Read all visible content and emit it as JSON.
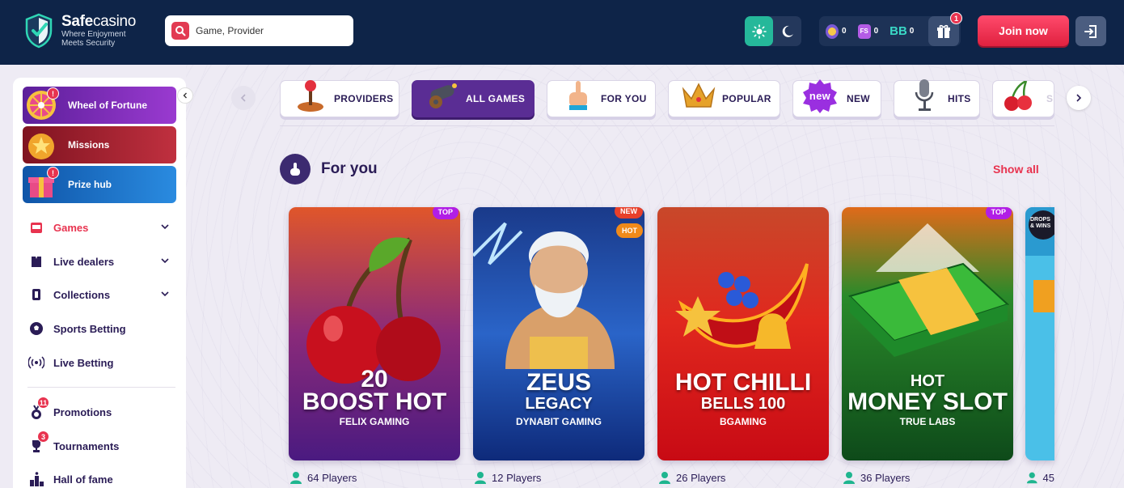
{
  "brand": {
    "name_bold": "Safe",
    "name_light": "casino",
    "tagline_line1": "Where Enjoyment",
    "tagline_line2": "Meets Security"
  },
  "search": {
    "placeholder": "Game, Provider"
  },
  "balances": {
    "coins": "0",
    "fs_label": "FS",
    "fs": "0",
    "bb_label": "BB",
    "bb": "0"
  },
  "gift_badge": "1",
  "join_label": "Join now",
  "sidebar": {
    "promos": [
      {
        "label": "Wheel of Fortune",
        "badge": "!",
        "color": "#7d2aa8"
      },
      {
        "label": "Missions",
        "color": "#a32030"
      },
      {
        "label": "Prize hub",
        "badge": "!",
        "color": "#1669c2"
      }
    ],
    "nav": [
      {
        "label": "Games",
        "active": true,
        "expandable": true,
        "icon": "slot-machine-icon"
      },
      {
        "label": "Live dealers",
        "expandable": true,
        "icon": "dealer-icon"
      },
      {
        "label": "Collections",
        "expandable": true,
        "icon": "cards-icon"
      },
      {
        "label": "Sports Betting",
        "icon": "soccer-ball-icon"
      },
      {
        "label": "Live Betting",
        "icon": "broadcast-icon"
      },
      {
        "label": "Promotions",
        "badge": "11",
        "icon": "medal-icon"
      },
      {
        "label": "Tournaments",
        "badge": "3",
        "icon": "trophy-icon"
      },
      {
        "label": "Hall of fame",
        "icon": "podium-icon"
      }
    ]
  },
  "categories": [
    {
      "label": "PROVIDERS",
      "icon": "joystick-icon"
    },
    {
      "label": "ALL GAMES",
      "active": true,
      "icon": "cannon-icon"
    },
    {
      "label": "FOR YOU",
      "icon": "pointing-hand-icon"
    },
    {
      "label": "POPULAR",
      "icon": "crown-icon"
    },
    {
      "label": "NEW",
      "icon": "new-badge-icon",
      "icon_text": "new"
    },
    {
      "label": "HITS",
      "icon": "microphone-icon"
    },
    {
      "label": "S",
      "icon": "cherries-icon"
    }
  ],
  "section": {
    "title": "For you",
    "show_all": "Show all"
  },
  "games": [
    {
      "title1": "20",
      "title2": "BOOST HOT",
      "provider": "FELIX GAMING",
      "tags": [
        "TOP"
      ],
      "players": "64 Players"
    },
    {
      "title1": "ZEUS",
      "title2": "LEGACY",
      "provider": "DYNABIT GAMING",
      "tags": [
        "NEW",
        "HOT"
      ],
      "players": "12 Players"
    },
    {
      "title1": "HOT CHILLI",
      "title2": "BELLS 100",
      "provider": "BGAMING",
      "tags": [],
      "players": "26 Players"
    },
    {
      "title1": "HOT",
      "title2": "MONEY SLOT",
      "provider": "TRUE LABS",
      "tags": [
        "TOP"
      ],
      "players": "36 Players"
    },
    {
      "title1": "",
      "title2": "",
      "provider": "",
      "tags": [],
      "players": "45",
      "partial_label": "DROPS & WINS"
    }
  ]
}
